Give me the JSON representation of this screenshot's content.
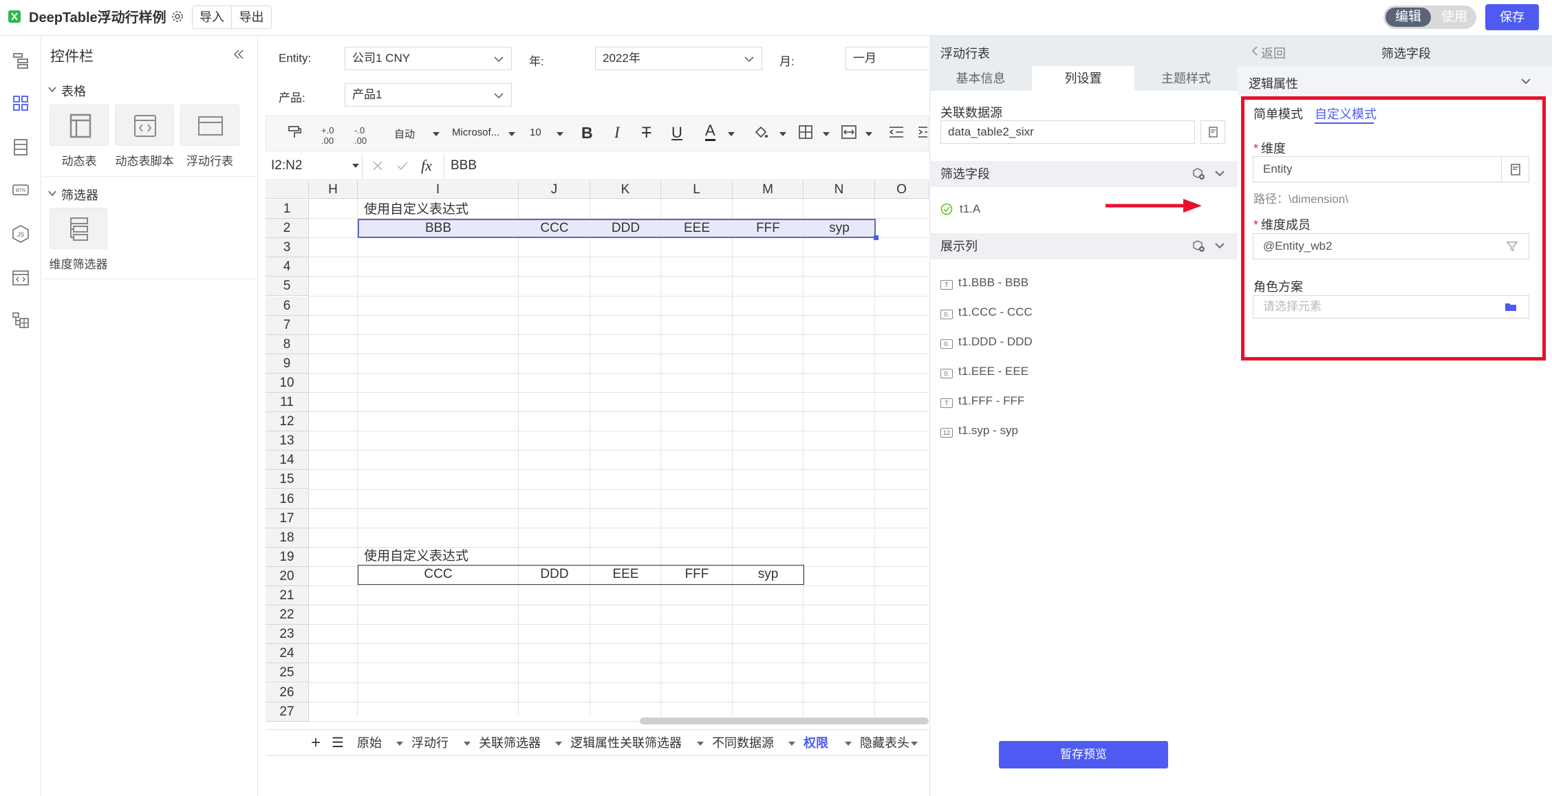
{
  "header": {
    "app_title": "DeepTable浮动行样例",
    "import_label": "导入",
    "export_label": "导出",
    "mode_edit": "编辑",
    "mode_use": "使用",
    "save_label": "保存"
  },
  "control_panel": {
    "title": "控件栏",
    "group_table": "表格",
    "group_filter": "筛选器",
    "table_items": [
      "动态表",
      "动态表脚本",
      "浮动行表"
    ],
    "filter_items": [
      "维度筛选器"
    ]
  },
  "params": {
    "entity_label": "Entity:",
    "entity_value": "公司1 CNY",
    "year_label": "年:",
    "year_value": "2022年",
    "month_label": "月:",
    "month_value": "一月",
    "product_label": "产品:",
    "product_value": "产品1"
  },
  "toolbar": {
    "auto": "自动",
    "font": "Microsof...",
    "size": "10"
  },
  "formula_bar": {
    "cell_ref": "I2:N2",
    "fx": "fx",
    "value": "BBB"
  },
  "sheet": {
    "columns": [
      "H",
      "I",
      "J",
      "K",
      "L",
      "M",
      "N",
      "O"
    ],
    "rows": [
      "1",
      "2",
      "3",
      "4",
      "5",
      "6",
      "7",
      "8",
      "9",
      "10",
      "11",
      "12",
      "13",
      "14",
      "15",
      "16",
      "17",
      "18",
      "19",
      "20",
      "21",
      "22",
      "23",
      "24",
      "25",
      "26",
      "27"
    ],
    "r1_text": "使用自定义表达式",
    "r2": [
      "BBB",
      "CCC",
      "DDD",
      "EEE",
      "FFF",
      "syp"
    ],
    "r19_text": "使用自定义表达式",
    "r20": [
      "CCC",
      "DDD",
      "EEE",
      "FFF",
      "syp"
    ]
  },
  "sheet_tabs": {
    "add": "+",
    "menu": "☰",
    "tabs": [
      "原始",
      "浮动行",
      "关联筛选器",
      "逻辑属性关联筛选器",
      "不同数据源",
      "权限",
      "隐藏表头"
    ],
    "active": "权限"
  },
  "mid_panel": {
    "title": "浮动行表",
    "tabs": [
      "基本信息",
      "列设置",
      "主题样式"
    ],
    "active_tab": "列设置",
    "datasource_label": "关联数据源",
    "datasource_value": "data_table2_sixr",
    "filter_section": "筛选字段",
    "filter_items": [
      "t1.A"
    ],
    "display_section": "展示列",
    "display_items": [
      "t1.BBB - BBB",
      "t1.CCC - CCC",
      "t1.DDD - DDD",
      "t1.EEE - EEE",
      "t1.FFF - FFF",
      "t1.syp - syp"
    ],
    "preview_button": "暂存预览"
  },
  "right_panel": {
    "back_label": "返回",
    "title": "筛选字段",
    "section": "逻辑属性",
    "mode_simple": "简单模式",
    "mode_custom": "自定义模式",
    "dimension_label": "维度",
    "dimension_value": "Entity",
    "path_text": "路径：\\dimension\\",
    "member_label": "维度成员",
    "member_value": "@Entity_wb2",
    "role_label": "角色方案",
    "role_placeholder": "请选择元素"
  },
  "colors": {
    "accent": "#4e5bf2",
    "highlight": "#e8e9f8",
    "annotation_red": "#e8112d"
  }
}
